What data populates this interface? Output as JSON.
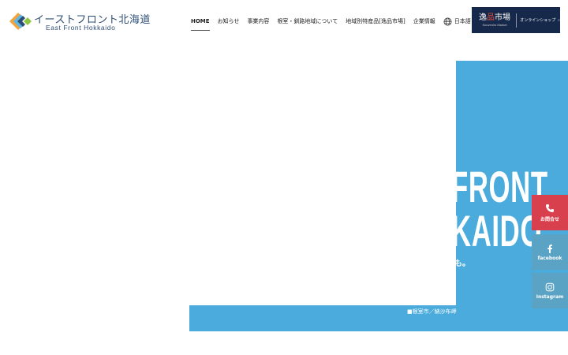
{
  "header": {
    "logo": {
      "jp": "イーストフロント北海道",
      "en": "East Front Hokkaido"
    },
    "nav": [
      {
        "label": "HOME",
        "active": true
      },
      {
        "label": "お知らせ"
      },
      {
        "label": "事業内容"
      },
      {
        "label": "根室・釧路地域について"
      },
      {
        "label": "地域別特産品[逸品市場]"
      },
      {
        "label": "企業情報"
      }
    ],
    "language": {
      "label": "日本語",
      "icon": "globe-icon"
    },
    "shop": {
      "logo_jp_a": "逸",
      "logo_jp_b": "品",
      "logo_jp_c": "市場",
      "logo_en": "Souvenirs Market",
      "label": "オンラインショップ"
    }
  },
  "hero": {
    "title_line1": "FRONT",
    "title_line2": "KAIDO",
    "tagline_tail": "も。",
    "caption": "■根室市／納沙布岬"
  },
  "side": {
    "contact_label": "お問合せ",
    "facebook_label": "facebook",
    "instagram_label": "Instagram"
  },
  "colors": {
    "accent_blue": "#4aabdc",
    "navy": "#17294a",
    "contact_red": "#d8404e",
    "social_blue": "#5aa3c4"
  }
}
